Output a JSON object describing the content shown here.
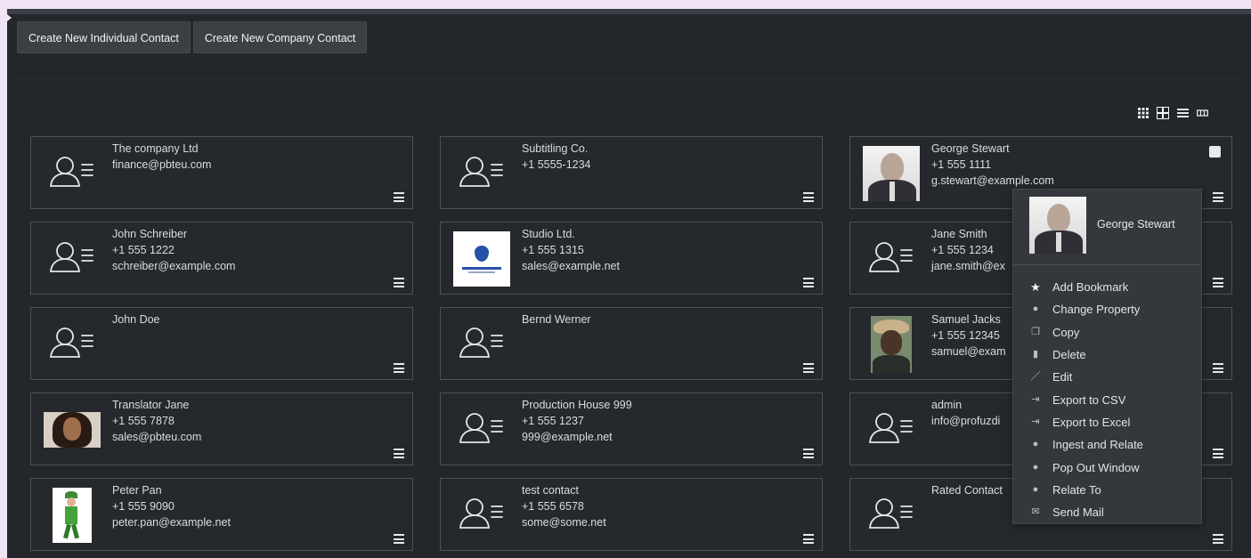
{
  "toolbar": {
    "create_individual": "Create New Individual Contact",
    "create_company": "Create New Company Contact"
  },
  "view_modes": [
    "small-grid",
    "large-grid",
    "list",
    "compact"
  ],
  "active_view": "large-grid",
  "contacts": [
    {
      "lines": [
        "The company Ltd",
        "finance@pbteu.com"
      ],
      "avatar": "person-placeholder-icon"
    },
    {
      "lines": [
        "Subtitling Co.",
        "+1 5555-1234"
      ],
      "avatar": "person-placeholder-icon"
    },
    {
      "lines": [
        "George Stewart",
        "+1 555 1111",
        "g.stewart@example.com"
      ],
      "avatar": "photo-george-stewart"
    },
    {
      "lines": [
        "John Schreiber",
        "+1 555 1222",
        "schreiber@example.com"
      ],
      "avatar": "person-placeholder-icon"
    },
    {
      "lines": [
        "Studio Ltd.",
        "+1 555 1315",
        "sales@example.net"
      ],
      "avatar": "company-logo"
    },
    {
      "lines": [
        "Jane Smith",
        "+1 555 1234",
        "jane.smith@ex"
      ],
      "avatar": "person-placeholder-icon"
    },
    {
      "lines": [
        "John Doe"
      ],
      "avatar": "person-placeholder-icon"
    },
    {
      "lines": [
        "Bernd Werner"
      ],
      "avatar": "person-placeholder-icon"
    },
    {
      "lines": [
        "Samuel Jacks",
        "+1 555 12345",
        "samuel@exam"
      ],
      "avatar": "photo-samuel-jackson"
    },
    {
      "lines": [
        "Translator Jane",
        "+1 555 7878",
        "sales@pbteu.com"
      ],
      "avatar": "photo-translator-jane"
    },
    {
      "lines": [
        "Production House 999",
        "+1 555 1237",
        "999@example.net"
      ],
      "avatar": "person-placeholder-icon"
    },
    {
      "lines": [
        "admin",
        "info@profuzdi"
      ],
      "avatar": "person-placeholder-icon"
    },
    {
      "lines": [
        "Peter Pan",
        "+1 555 9090",
        "peter.pan@example.net"
      ],
      "avatar": "photo-peter-pan"
    },
    {
      "lines": [
        "test contact",
        "+1 555 6578",
        "some@some.net"
      ],
      "avatar": "person-placeholder-icon"
    },
    {
      "lines": [
        "Rated Contact"
      ],
      "avatar": "person-placeholder-icon"
    }
  ],
  "context_menu": {
    "title": "George Stewart",
    "items": [
      {
        "label": "Add Bookmark",
        "icon": "star-icon"
      },
      {
        "label": "Change Property",
        "icon": "property-icon"
      },
      {
        "label": "Copy",
        "icon": "copy-icon"
      },
      {
        "label": "Delete",
        "icon": "trash-icon"
      },
      {
        "label": "Edit",
        "icon": "pencil-icon"
      },
      {
        "label": "Export to CSV",
        "icon": "export-icon"
      },
      {
        "label": "Export to Excel",
        "icon": "export-icon"
      },
      {
        "label": "Ingest and Relate",
        "icon": "property-icon"
      },
      {
        "label": "Pop Out Window",
        "icon": "property-icon"
      },
      {
        "label": "Relate To",
        "icon": "property-icon"
      },
      {
        "label": "Send Mail",
        "icon": "mail-icon"
      }
    ]
  }
}
